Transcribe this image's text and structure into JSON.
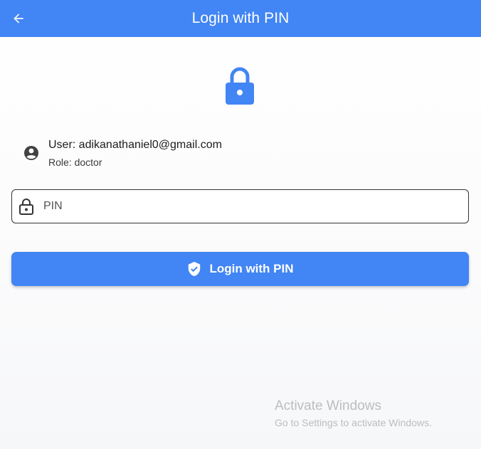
{
  "appbar": {
    "title": "Login with PIN",
    "back_icon": "arrow-left-icon"
  },
  "hero": {
    "icon": "lock-icon"
  },
  "user": {
    "avatar_icon": "account-circle-icon",
    "email_text": "User: adikanathaniel0@gmail.com",
    "role_text": "Role: doctor"
  },
  "pin_field": {
    "placeholder": "PIN",
    "value": "",
    "icon": "lock-outline-icon"
  },
  "login_button": {
    "label": "Login with PIN",
    "icon": "verified-shield-icon"
  },
  "watermark": {
    "title": "Activate Windows",
    "subtitle": "Go to Settings to activate Windows."
  },
  "colors": {
    "primary": "#4285f4",
    "text": "#1d1d1d",
    "watermark": "#bdbdbd"
  }
}
